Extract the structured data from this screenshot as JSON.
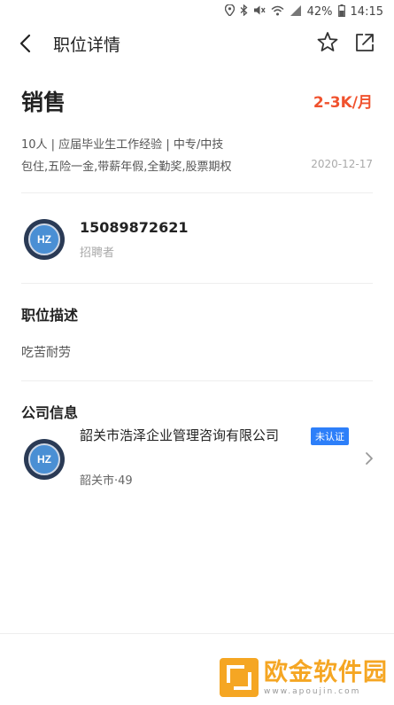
{
  "status_bar": {
    "battery": "42%",
    "time": "14:15",
    "icons": [
      "location-icon",
      "bluetooth-icon",
      "mute-icon",
      "wifi-icon",
      "signal-icon",
      "battery-icon"
    ]
  },
  "nav": {
    "title": "职位详情",
    "icons": [
      "back-arrow-icon",
      "star-icon",
      "share-icon"
    ]
  },
  "job": {
    "title": "销售",
    "salary": "2-3K/月",
    "meta": "10人 | 应届毕业生工作经验 | 中专/中技",
    "benefits": "包住,五险一金,带薪年假,全勤奖,股票期权",
    "date": "2020-12-17"
  },
  "recruiter": {
    "logo_text": "HZ",
    "name": "15089872621",
    "role": "招聘者"
  },
  "description": {
    "heading": "职位描述",
    "text": "吃苦耐劳"
  },
  "company": {
    "heading": "公司信息",
    "logo_text": "HZ",
    "name": "韶关市浩泽企业管理咨询有限公司",
    "badge": "未认证",
    "location": "韶关市·49"
  },
  "watermark": {
    "title": "欧金软件园",
    "url": "www.apoujin.com"
  },
  "colors": {
    "salary": "#f0522e",
    "badge": "#2d7ff9",
    "watermark": "#f5a623"
  }
}
